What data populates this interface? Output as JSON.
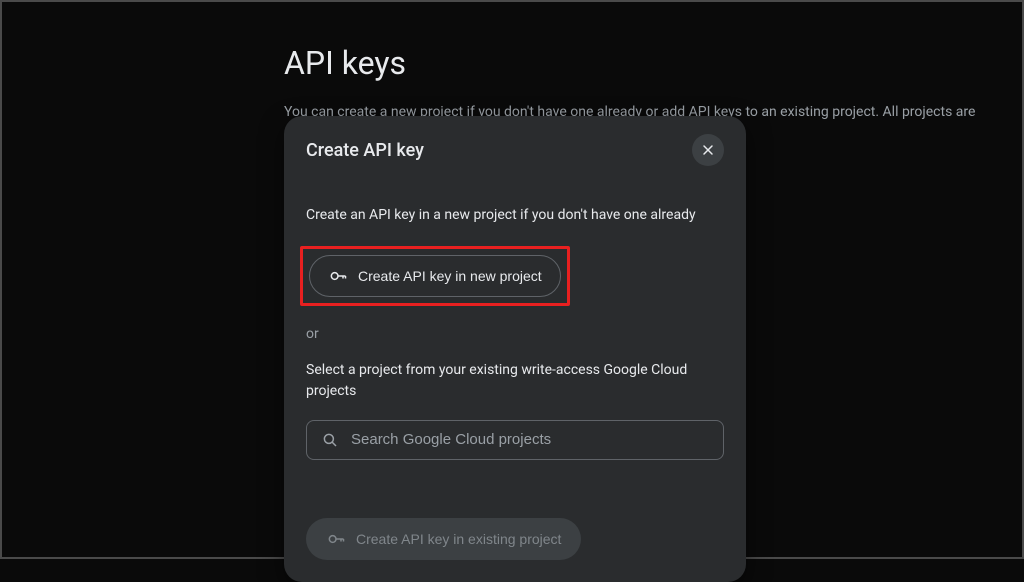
{
  "page": {
    "title": "API keys",
    "description": "You can create a new project if you don't have one already or add API keys to an existing project. All projects are"
  },
  "modal": {
    "title": "Create API key",
    "close_icon": "close",
    "description": "Create an API key in a new project if you don't have one already",
    "new_project_button": "Create API key in new project",
    "or_label": "or",
    "select_text": "Select a project from your existing write-access Google Cloud projects",
    "search_placeholder": "Search Google Cloud projects",
    "existing_project_button": "Create API key in existing project"
  }
}
